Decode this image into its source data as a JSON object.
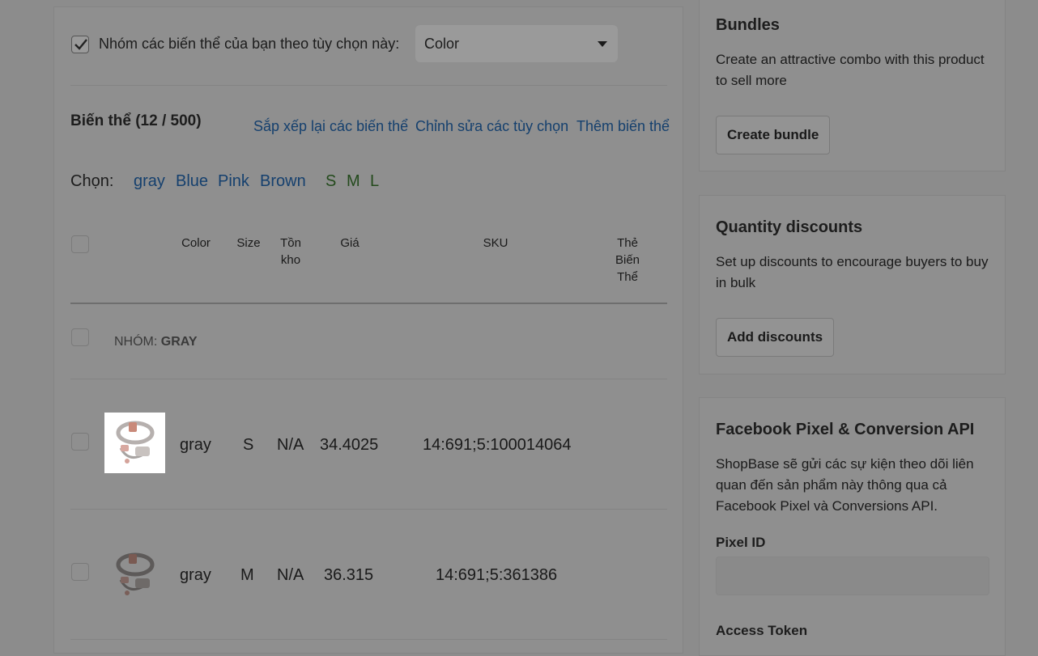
{
  "grouping": {
    "checkbox_label": "Nhóm các biến thể của bạn theo tùy chọn này:",
    "select_value": "Color"
  },
  "variants": {
    "heading": "Biến thể (12 / 500)",
    "actions": {
      "reorder": "Sắp xếp lại các biến thể",
      "edit_options": "Chỉnh sửa các tùy chọn",
      "add_variant": "Thêm biến thể"
    },
    "select_label": "Chọn:",
    "color_filters": [
      "gray",
      "Blue",
      "Pink",
      "Brown"
    ],
    "size_filters": [
      "S",
      "M",
      "L"
    ],
    "columns": {
      "color": "Color",
      "size": "Size",
      "inventory_line1": "Tồn",
      "inventory_line2": "kho",
      "price": "Giá",
      "sku": "SKU",
      "tags_line1": "Thẻ",
      "tags_line2": "Biến",
      "tags_line3": "Thể"
    },
    "group": {
      "prefix": "NHÓM: ",
      "name": "GRAY"
    },
    "rows": [
      {
        "color": "gray",
        "size": "S",
        "inventory": "N/A",
        "price": "34.4025",
        "sku": "14:691;5:100014064"
      },
      {
        "color": "gray",
        "size": "M",
        "inventory": "N/A",
        "price": "36.315",
        "sku": "14:691;5:361386"
      }
    ]
  },
  "bundles": {
    "title": "Bundles",
    "description": "Create an attractive combo with this product to sell more",
    "button": "Create bundle"
  },
  "quantity_discounts": {
    "title": "Quantity discounts",
    "description": "Set up discounts to encourage buyers to buy in bulk",
    "button": "Add discounts"
  },
  "facebook_pixel": {
    "title": "Facebook Pixel & Conversion API",
    "description": "ShopBase sẽ gửi các sự kiện theo dõi liên quan đến sản phẩm này thông qua cả Facebook Pixel và Conversions API.",
    "pixel_id_label": "Pixel ID",
    "pixel_id_value": "",
    "access_token_label": "Access Token"
  }
}
